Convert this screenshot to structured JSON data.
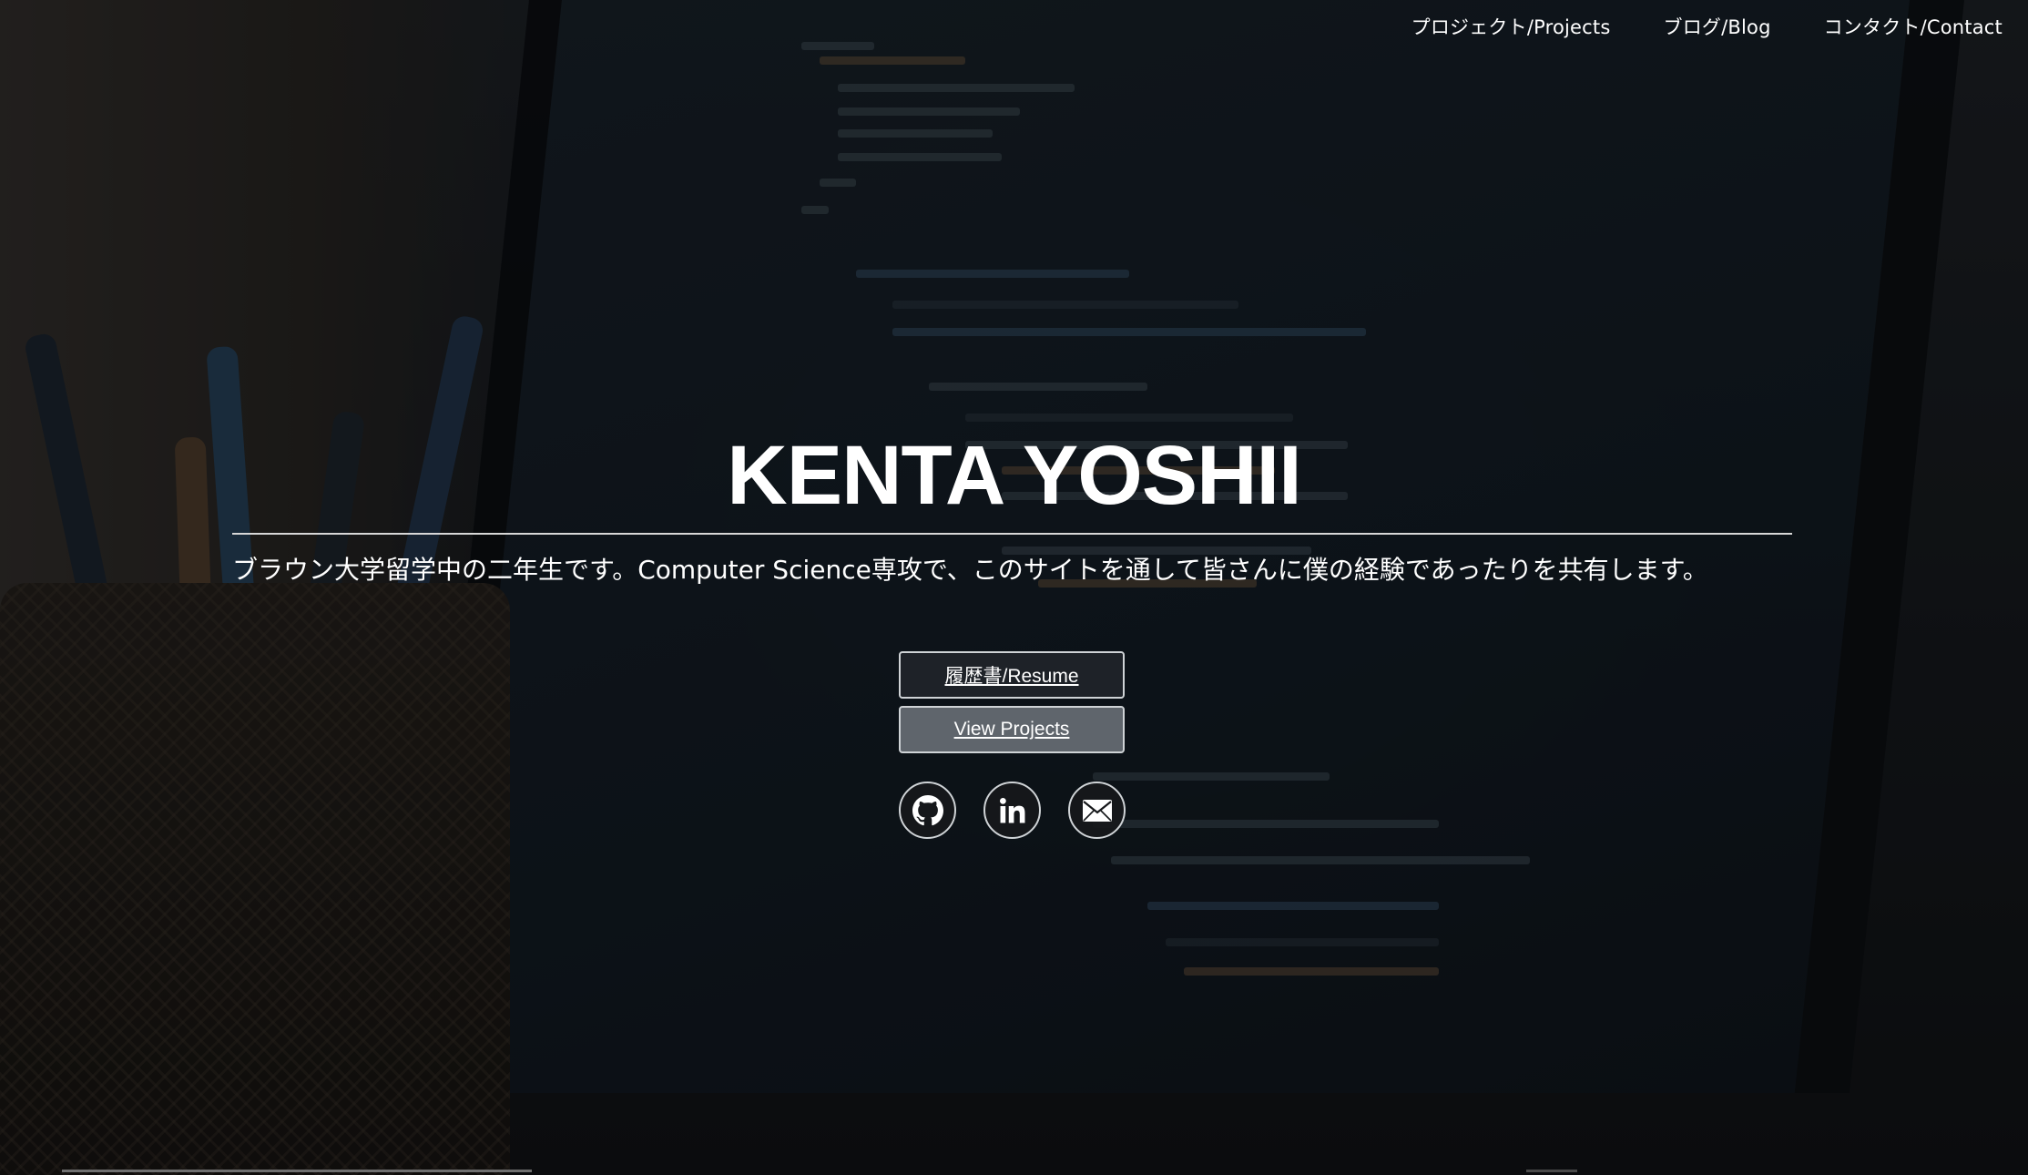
{
  "nav": {
    "projects": "プロジェクト/Projects",
    "blog": "ブログ/Blog",
    "contact": "コンタクト/Contact"
  },
  "hero": {
    "title": "KENTA YOSHII",
    "tagline": "ブラウン大学留学中の二年生です。Computer Science専攻で、このサイトを通して皆さんに僕の経験であったりを共有します。",
    "resume_button": "履歴書/Resume",
    "projects_button": "View Projects"
  },
  "social": {
    "icons": [
      "github-icon",
      "linkedin-icon",
      "mail-icon"
    ]
  },
  "colors": {
    "text": "#ffffff",
    "button_border": "#cfd3d6",
    "projects_button_bg": "#5f656c",
    "overlay": "#000000"
  }
}
